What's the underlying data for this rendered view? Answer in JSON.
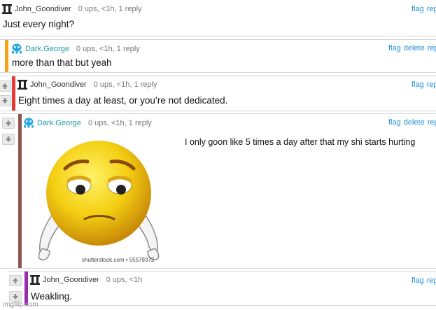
{
  "comments": [
    {
      "user": "John_Goondiver",
      "meta": "0 ups, <1h, 1 reply",
      "text": "Just every night?",
      "actions": [
        "flag",
        "rep"
      ]
    },
    {
      "user": "Dark.George",
      "meta": "0 ups, <1h, 1 reply",
      "text": "more than that but yeah",
      "actions": [
        "flag",
        "delete",
        "rep"
      ]
    },
    {
      "user": "John_Goondiver",
      "meta": "0 ups, <1h, 1 reply",
      "text": "Eight times a day at least, or you’re not dedicated.",
      "actions": [
        "flag",
        "rep"
      ]
    },
    {
      "user": "Dark.George",
      "meta": "0 ups, <1h, 1 reply",
      "text": "I only goon like 5 times a day after that my shi starts hurting",
      "actions": [
        "flag",
        "delete",
        "rep"
      ],
      "image_caption": "shutterstock.com • 55579372"
    },
    {
      "user": "John_Goondiver",
      "meta": "0 ups, <1h",
      "text": "Weakling.",
      "actions": [
        "flag",
        "rep"
      ]
    }
  ],
  "watermark": "imgflip.com",
  "colors": {
    "orange": "#f5a21b",
    "red": "#e53935",
    "brown": "#8d5652",
    "purple": "#9c27b0",
    "link": "#1e8fd6",
    "teal": "#1f9aa6"
  },
  "icons": {
    "john": "pillar-icon",
    "george": "alien-icon",
    "up": "up-arrow-icon",
    "down": "down-arrow-icon"
  }
}
